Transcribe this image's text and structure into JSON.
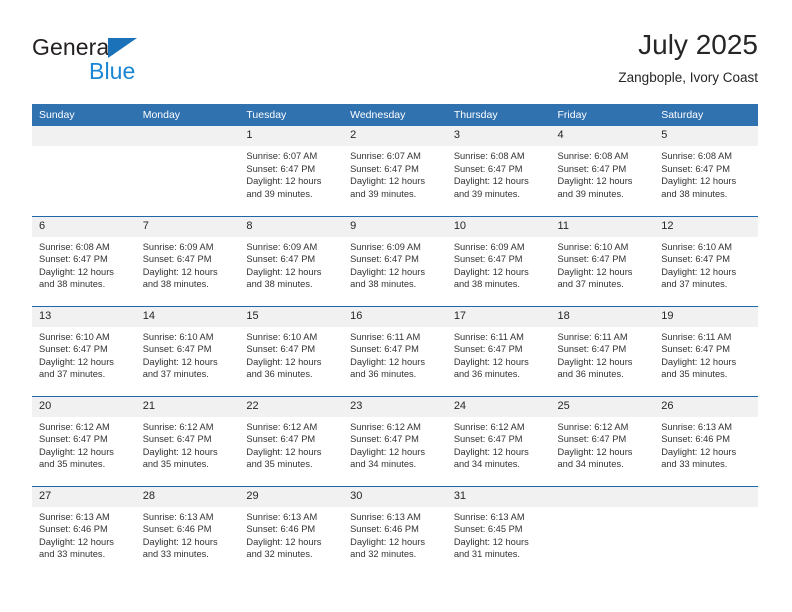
{
  "brand": {
    "name_top": "General",
    "name_bottom": "Blue",
    "triangle_icon": "brand-triangle-icon",
    "colors": {
      "general": "#231f20",
      "blue": "#1b86d4",
      "triangle": "#1b72b8"
    }
  },
  "header": {
    "title": "July 2025",
    "subtitle": "Zangbople, Ivory Coast"
  },
  "theme": {
    "header_blue": "#3071b0",
    "row_divider_blue": "#1f66ab",
    "daynum_band": "#f1f1f1",
    "text": "#262626"
  },
  "calendar": {
    "weekday_headers": [
      "Sunday",
      "Monday",
      "Tuesday",
      "Wednesday",
      "Thursday",
      "Friday",
      "Saturday"
    ],
    "weeks": [
      [
        {
          "day": "",
          "lines": []
        },
        {
          "day": "",
          "lines": []
        },
        {
          "day": "1",
          "lines": [
            "Sunrise: 6:07 AM",
            "Sunset: 6:47 PM",
            "Daylight: 12 hours",
            "and 39 minutes."
          ]
        },
        {
          "day": "2",
          "lines": [
            "Sunrise: 6:07 AM",
            "Sunset: 6:47 PM",
            "Daylight: 12 hours",
            "and 39 minutes."
          ]
        },
        {
          "day": "3",
          "lines": [
            "Sunrise: 6:08 AM",
            "Sunset: 6:47 PM",
            "Daylight: 12 hours",
            "and 39 minutes."
          ]
        },
        {
          "day": "4",
          "lines": [
            "Sunrise: 6:08 AM",
            "Sunset: 6:47 PM",
            "Daylight: 12 hours",
            "and 39 minutes."
          ]
        },
        {
          "day": "5",
          "lines": [
            "Sunrise: 6:08 AM",
            "Sunset: 6:47 PM",
            "Daylight: 12 hours",
            "and 38 minutes."
          ]
        }
      ],
      [
        {
          "day": "6",
          "lines": [
            "Sunrise: 6:08 AM",
            "Sunset: 6:47 PM",
            "Daylight: 12 hours",
            "and 38 minutes."
          ]
        },
        {
          "day": "7",
          "lines": [
            "Sunrise: 6:09 AM",
            "Sunset: 6:47 PM",
            "Daylight: 12 hours",
            "and 38 minutes."
          ]
        },
        {
          "day": "8",
          "lines": [
            "Sunrise: 6:09 AM",
            "Sunset: 6:47 PM",
            "Daylight: 12 hours",
            "and 38 minutes."
          ]
        },
        {
          "day": "9",
          "lines": [
            "Sunrise: 6:09 AM",
            "Sunset: 6:47 PM",
            "Daylight: 12 hours",
            "and 38 minutes."
          ]
        },
        {
          "day": "10",
          "lines": [
            "Sunrise: 6:09 AM",
            "Sunset: 6:47 PM",
            "Daylight: 12 hours",
            "and 38 minutes."
          ]
        },
        {
          "day": "11",
          "lines": [
            "Sunrise: 6:10 AM",
            "Sunset: 6:47 PM",
            "Daylight: 12 hours",
            "and 37 minutes."
          ]
        },
        {
          "day": "12",
          "lines": [
            "Sunrise: 6:10 AM",
            "Sunset: 6:47 PM",
            "Daylight: 12 hours",
            "and 37 minutes."
          ]
        }
      ],
      [
        {
          "day": "13",
          "lines": [
            "Sunrise: 6:10 AM",
            "Sunset: 6:47 PM",
            "Daylight: 12 hours",
            "and 37 minutes."
          ]
        },
        {
          "day": "14",
          "lines": [
            "Sunrise: 6:10 AM",
            "Sunset: 6:47 PM",
            "Daylight: 12 hours",
            "and 37 minutes."
          ]
        },
        {
          "day": "15",
          "lines": [
            "Sunrise: 6:10 AM",
            "Sunset: 6:47 PM",
            "Daylight: 12 hours",
            "and 36 minutes."
          ]
        },
        {
          "day": "16",
          "lines": [
            "Sunrise: 6:11 AM",
            "Sunset: 6:47 PM",
            "Daylight: 12 hours",
            "and 36 minutes."
          ]
        },
        {
          "day": "17",
          "lines": [
            "Sunrise: 6:11 AM",
            "Sunset: 6:47 PM",
            "Daylight: 12 hours",
            "and 36 minutes."
          ]
        },
        {
          "day": "18",
          "lines": [
            "Sunrise: 6:11 AM",
            "Sunset: 6:47 PM",
            "Daylight: 12 hours",
            "and 36 minutes."
          ]
        },
        {
          "day": "19",
          "lines": [
            "Sunrise: 6:11 AM",
            "Sunset: 6:47 PM",
            "Daylight: 12 hours",
            "and 35 minutes."
          ]
        }
      ],
      [
        {
          "day": "20",
          "lines": [
            "Sunrise: 6:12 AM",
            "Sunset: 6:47 PM",
            "Daylight: 12 hours",
            "and 35 minutes."
          ]
        },
        {
          "day": "21",
          "lines": [
            "Sunrise: 6:12 AM",
            "Sunset: 6:47 PM",
            "Daylight: 12 hours",
            "and 35 minutes."
          ]
        },
        {
          "day": "22",
          "lines": [
            "Sunrise: 6:12 AM",
            "Sunset: 6:47 PM",
            "Daylight: 12 hours",
            "and 35 minutes."
          ]
        },
        {
          "day": "23",
          "lines": [
            "Sunrise: 6:12 AM",
            "Sunset: 6:47 PM",
            "Daylight: 12 hours",
            "and 34 minutes."
          ]
        },
        {
          "day": "24",
          "lines": [
            "Sunrise: 6:12 AM",
            "Sunset: 6:47 PM",
            "Daylight: 12 hours",
            "and 34 minutes."
          ]
        },
        {
          "day": "25",
          "lines": [
            "Sunrise: 6:12 AM",
            "Sunset: 6:47 PM",
            "Daylight: 12 hours",
            "and 34 minutes."
          ]
        },
        {
          "day": "26",
          "lines": [
            "Sunrise: 6:13 AM",
            "Sunset: 6:46 PM",
            "Daylight: 12 hours",
            "and 33 minutes."
          ]
        }
      ],
      [
        {
          "day": "27",
          "lines": [
            "Sunrise: 6:13 AM",
            "Sunset: 6:46 PM",
            "Daylight: 12 hours",
            "and 33 minutes."
          ]
        },
        {
          "day": "28",
          "lines": [
            "Sunrise: 6:13 AM",
            "Sunset: 6:46 PM",
            "Daylight: 12 hours",
            "and 33 minutes."
          ]
        },
        {
          "day": "29",
          "lines": [
            "Sunrise: 6:13 AM",
            "Sunset: 6:46 PM",
            "Daylight: 12 hours",
            "and 32 minutes."
          ]
        },
        {
          "day": "30",
          "lines": [
            "Sunrise: 6:13 AM",
            "Sunset: 6:46 PM",
            "Daylight: 12 hours",
            "and 32 minutes."
          ]
        },
        {
          "day": "31",
          "lines": [
            "Sunrise: 6:13 AM",
            "Sunset: 6:45 PM",
            "Daylight: 12 hours",
            "and 31 minutes."
          ]
        },
        {
          "day": "",
          "lines": []
        },
        {
          "day": "",
          "lines": []
        }
      ]
    ]
  }
}
